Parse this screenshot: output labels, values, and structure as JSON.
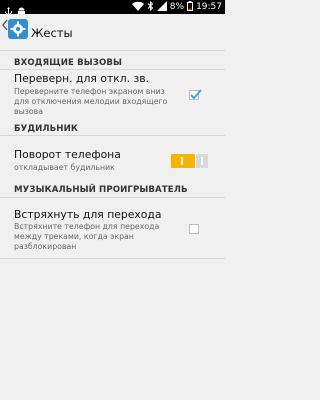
{
  "status": {
    "battery": "8%",
    "time": "19:57",
    "icons": [
      "usb-icon",
      "android-icon",
      "wifi-icon",
      "bluetooth-icon",
      "signal-icon",
      "battery-icon"
    ]
  },
  "header": {
    "title": "Жесты",
    "icon": "gear-icon"
  },
  "sections": [
    {
      "header": "ВХОДЯЩИЕ ВЫЗОВЫ",
      "items": [
        {
          "title": "Переверн. для откл. зв.",
          "summary": "Переверните телефон экраном вниз для отключения мелодии входящего вызова",
          "control": "checkbox",
          "checked": true
        }
      ]
    },
    {
      "header": "БУДИЛЬНИК",
      "items": [
        {
          "title": "Поворот телефона",
          "summary": "откладывает будильник",
          "control": "switch",
          "on": true
        }
      ]
    },
    {
      "header": "МУЗЫКАЛЬНЫЙ ПРОИГРЫВАТЕЛЬ",
      "items": [
        {
          "title": "Встряхнуть для перехода",
          "summary": "Встряхните телефон для перехода между треками, когда экран разблокирован",
          "control": "checkbox",
          "checked": false
        }
      ]
    }
  ],
  "colors": {
    "accent": "#f6b300",
    "check": "#3fa9e0",
    "background": "#f0f0f0"
  }
}
